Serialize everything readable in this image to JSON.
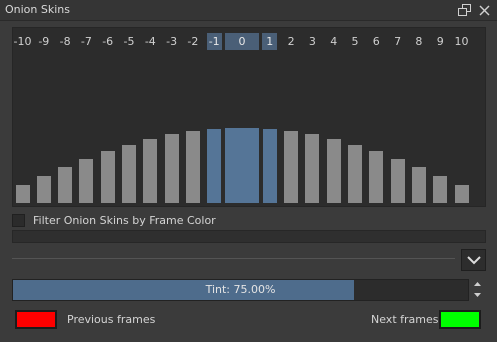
{
  "window": {
    "title": "Onion Skins"
  },
  "frames": {
    "labels": [
      "-10",
      "-9",
      "-8",
      "-7",
      "-6",
      "-5",
      "-4",
      "-3",
      "-2",
      "-1",
      "0",
      "1",
      "2",
      "3",
      "4",
      "5",
      "6",
      "7",
      "8",
      "9",
      "10"
    ],
    "selected": [
      "-1",
      "0",
      "1"
    ]
  },
  "filter": {
    "label": "Filter Onion Skins by Frame Color",
    "checked": false
  },
  "tint": {
    "text": "Tint: 75.00%",
    "value_percent": 75
  },
  "colors": {
    "previous": "#ff0000",
    "next": "#00ff00",
    "bar": "#8a8a8a",
    "bar_selected": "#557597",
    "accent": "#4e6c8c"
  },
  "previous_frames": {
    "label": "Previous frames"
  },
  "next_frames": {
    "label": "Next frames"
  },
  "icons": {
    "float": "float-window-icon",
    "close": "close-icon",
    "expand": "chevron-down-icon",
    "spin_up": "spin-up-icon",
    "spin_down": "spin-down-icon"
  }
}
